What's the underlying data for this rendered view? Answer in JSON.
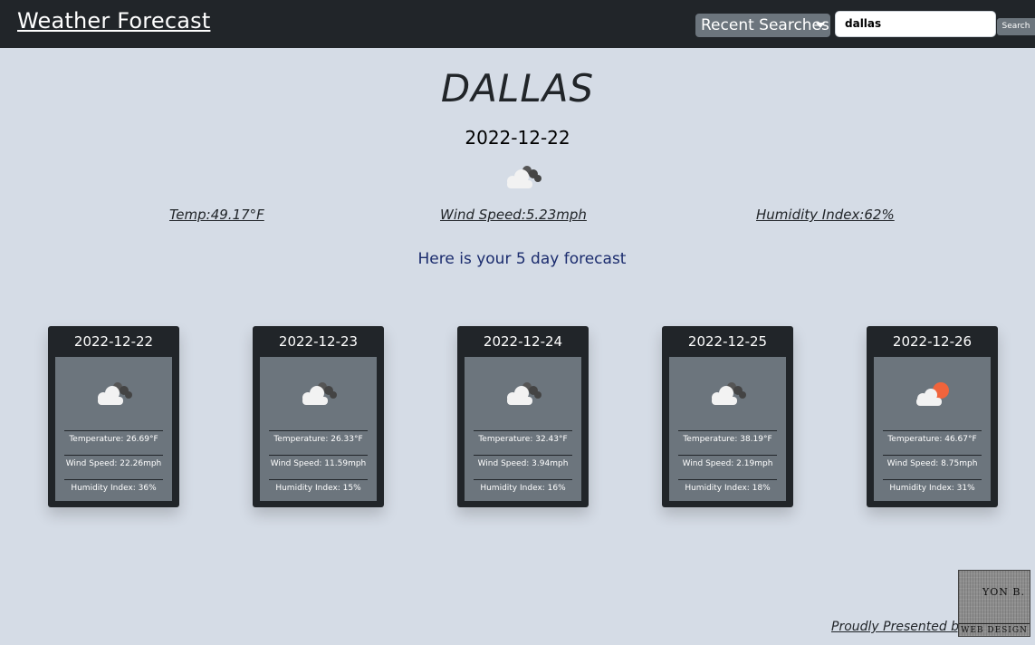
{
  "navbar": {
    "brand": "Weather Forecast",
    "recent_label": "Recent Searches",
    "search_value": "dallas",
    "search_button": "Search"
  },
  "current": {
    "city": "DALLAS",
    "date": "2022-12-22",
    "icon": "cloudy-icon",
    "temp": "Temp:49.17°F",
    "wind": "Wind Speed:5.23mph",
    "humidity": "Humidity Index:62%"
  },
  "tagline": "Here is your 5 day forecast",
  "forecast": [
    {
      "date": "2022-12-22",
      "icon": "cloudy-icon",
      "temp": "Temperature: 26.69°F",
      "wind": "Wind Speed: 22.26mph",
      "humidity": "Humidity Index: 36%"
    },
    {
      "date": "2022-12-23",
      "icon": "cloudy-icon",
      "temp": "Temperature: 26.33°F",
      "wind": "Wind Speed: 11.59mph",
      "humidity": "Humidity Index: 15%"
    },
    {
      "date": "2022-12-24",
      "icon": "cloudy-icon",
      "temp": "Temperature: 32.43°F",
      "wind": "Wind Speed: 3.94mph",
      "humidity": "Humidity Index: 16%"
    },
    {
      "date": "2022-12-25",
      "icon": "cloudy-icon",
      "temp": "Temperature: 38.19°F",
      "wind": "Wind Speed: 2.19mph",
      "humidity": "Humidity Index: 18%"
    },
    {
      "date": "2022-12-26",
      "icon": "partly-cloudy-sun-icon",
      "temp": "Temperature: 46.67°F",
      "wind": "Wind Speed: 8.75mph",
      "humidity": "Humidity Index: 31%"
    }
  ],
  "footer": {
    "text": "Proudly Presented by",
    "logo_top": "YON B.",
    "logo_bottom": "WEB DESIGN"
  },
  "colors": {
    "background": "#d5dce6",
    "navbar": "#212529",
    "card_body": "#6c757d",
    "tagline": "#1a2b6d",
    "sun": "#f0643c"
  }
}
